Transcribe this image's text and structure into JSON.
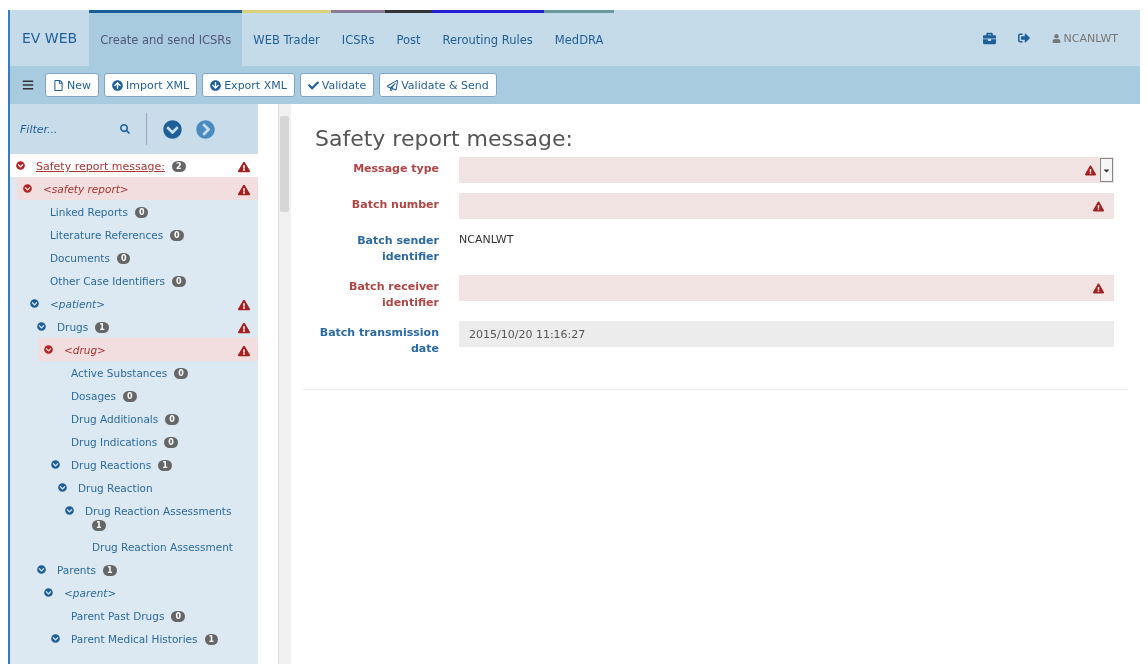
{
  "brand": "EV WEB",
  "nav": [
    {
      "label": "Create and send ICSRs",
      "selected": true,
      "color": "#1a5e96"
    },
    {
      "label": "WEB Trader",
      "selected": false,
      "color": "#d9d27a"
    },
    {
      "label": "ICSRs",
      "selected": false,
      "color": "#8a7a99"
    },
    {
      "label": "Post",
      "selected": false,
      "color": "#333333"
    },
    {
      "label": "Rerouting Rules",
      "selected": false,
      "color": "#2222d0"
    },
    {
      "label": "MedDRA",
      "selected": false,
      "color": "#6a9a9a"
    }
  ],
  "user": "NCANLWT",
  "toolbar": [
    {
      "label": "New"
    },
    {
      "label": "Import XML"
    },
    {
      "label": "Export XML"
    },
    {
      "label": "Validate"
    },
    {
      "label": "Validate & Send"
    }
  ],
  "filter": {
    "placeholder": "Filter..."
  },
  "tree": [
    {
      "label": "Safety report message:",
      "count": "2",
      "kind": "root",
      "selected": true,
      "highlighted": false,
      "error": true,
      "expanded": true,
      "children": [
        {
          "label": "<safety report>",
          "kind": "element",
          "selected": false,
          "highlighted": true,
          "error": true,
          "expanded": true,
          "children": [
            {
              "label": "Linked Reports",
              "count": "0",
              "kind": "group",
              "selected": false,
              "highlighted": false,
              "error": false
            },
            {
              "label": "Literature References",
              "count": "0",
              "kind": "group",
              "selected": false,
              "highlighted": false,
              "error": false
            },
            {
              "label": "Documents",
              "count": "0",
              "kind": "group",
              "selected": false,
              "highlighted": false,
              "error": false
            },
            {
              "label": "Other Case Identifiers",
              "count": "0",
              "kind": "group",
              "selected": false,
              "highlighted": false,
              "error": false
            },
            {
              "label": "<patient>",
              "kind": "element",
              "selected": false,
              "highlighted": false,
              "error": true,
              "expanded": true,
              "children": [
                {
                  "label": "Drugs",
                  "count": "1",
                  "kind": "group",
                  "selected": false,
                  "highlighted": false,
                  "error": true,
                  "expanded": true,
                  "children": [
                    {
                      "label": "<drug>",
                      "kind": "element",
                      "selected": false,
                      "highlighted": true,
                      "error": true,
                      "expanded": true,
                      "children": [
                        {
                          "label": "Active Substances",
                          "count": "0",
                          "kind": "group",
                          "selected": false,
                          "highlighted": false,
                          "error": false
                        },
                        {
                          "label": "Dosages",
                          "count": "0",
                          "kind": "group",
                          "selected": false,
                          "highlighted": false,
                          "error": false
                        },
                        {
                          "label": "Drug Additionals",
                          "count": "0",
                          "kind": "group",
                          "selected": false,
                          "highlighted": false,
                          "error": false
                        },
                        {
                          "label": "Drug Indications",
                          "count": "0",
                          "kind": "group",
                          "selected": false,
                          "highlighted": false,
                          "error": false
                        },
                        {
                          "label": "Drug Reactions",
                          "count": "1",
                          "kind": "group",
                          "selected": false,
                          "highlighted": false,
                          "error": false,
                          "expanded": true,
                          "children": [
                            {
                              "label": "Drug Reaction",
                              "kind": "group",
                              "selected": false,
                              "highlighted": false,
                              "error": false,
                              "expanded": true,
                              "children": [
                                {
                                  "label": "Drug Reaction Assessments",
                                  "count": "1",
                                  "kind": "group",
                                  "selected": false,
                                  "highlighted": false,
                                  "error": false,
                                  "expanded": true,
                                  "children": [
                                    {
                                      "label": "Drug Reaction Assessment",
                                      "kind": "group",
                                      "selected": false,
                                      "highlighted": false,
                                      "error": false
                                    }
                                  ]
                                }
                              ]
                            }
                          ]
                        }
                      ]
                    }
                  ]
                },
                {
                  "label": "Parents",
                  "count": "1",
                  "kind": "group",
                  "selected": false,
                  "highlighted": false,
                  "error": false,
                  "expanded": true,
                  "children": [
                    {
                      "label": "<parent>",
                      "kind": "element",
                      "selected": false,
                      "highlighted": false,
                      "error": false,
                      "expanded": true,
                      "children": [
                        {
                          "label": "Parent Past Drugs",
                          "count": "0",
                          "kind": "group",
                          "selected": false,
                          "highlighted": false,
                          "error": false
                        },
                        {
                          "label": "Parent Medical Histories",
                          "count": "1",
                          "kind": "group",
                          "selected": false,
                          "highlighted": false,
                          "error": false,
                          "expanded": true
                        }
                      ]
                    }
                  ]
                }
              ]
            }
          ]
        }
      ]
    }
  ],
  "form": {
    "title": "Safety report message:",
    "fields": [
      {
        "label": "Message type",
        "kind": "select",
        "error": true
      },
      {
        "label": "Batch number",
        "kind": "input",
        "error": true
      },
      {
        "label": "Batch sender identifier",
        "kind": "static",
        "error": false,
        "value": "NCANLWT"
      },
      {
        "label": "Batch receiver identifier",
        "kind": "input",
        "error": true
      },
      {
        "label": "Batch transmission date",
        "kind": "readonly",
        "error": false,
        "value": "2015/10/20 11:16:27"
      }
    ]
  }
}
